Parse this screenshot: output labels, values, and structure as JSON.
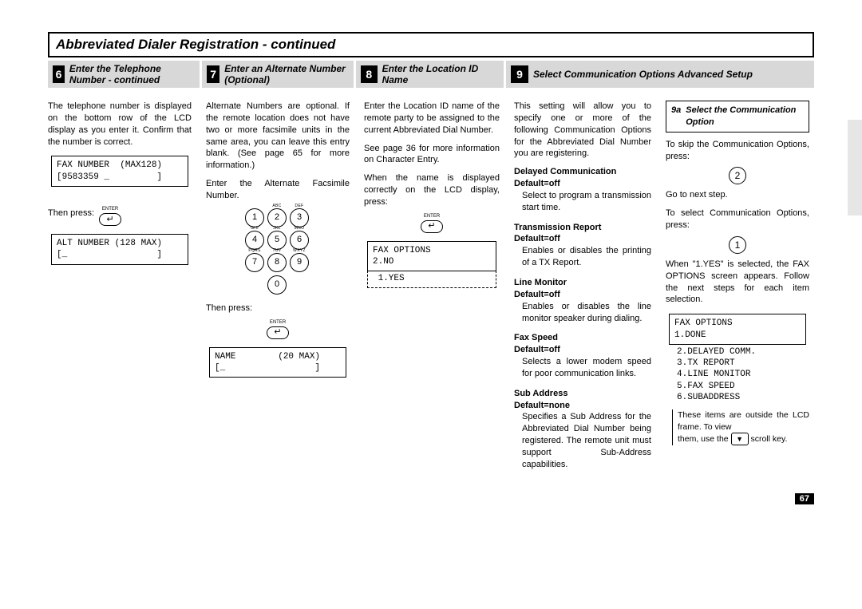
{
  "title": "Abbreviated Dialer Registration - continued",
  "page_number": "67",
  "steps": {
    "s6": {
      "num": "6",
      "label": "Enter the Telephone Number - continued"
    },
    "s7": {
      "num": "7",
      "label": "Enter an Alternate Number (Optional)"
    },
    "s8": {
      "num": "8",
      "label": "Enter the Location ID Name"
    },
    "s9": {
      "num": "9",
      "label": "Select Communication Options Advanced Setup"
    }
  },
  "col1": {
    "p1": "The telephone number is displayed on the bottom row of the LCD display as you enter it. Confirm that the number is correct.",
    "lcd1": "FAX NUMBER  (MAX128)\n[9583359 _         ]",
    "then_press": "Then press:",
    "enter": "ENTER",
    "enter_symbol": "↵",
    "lcd2": "ALT NUMBER (128 MAX)\n[_                 ]"
  },
  "col2": {
    "p1": "Alternate Numbers are optional. If the remote location does not have two or more facsimile units in the same area, you can leave this entry blank. (See page 65 for more information.)",
    "p2": "Enter the Alternate Facsimile Number.",
    "then_press": "Then press:",
    "enter": "ENTER",
    "enter_symbol": "↵",
    "lcd1": "NAME        (20 MAX)\n[_                 ]",
    "keypad": {
      "k1": {
        "d": "1",
        "t": ""
      },
      "k2": {
        "d": "2",
        "t": "ABC"
      },
      "k3": {
        "d": "3",
        "t": "DEF"
      },
      "k4": {
        "d": "4",
        "t": "GHI"
      },
      "k5": {
        "d": "5",
        "t": "JKL"
      },
      "k6": {
        "d": "6",
        "t": "MNO"
      },
      "k7": {
        "d": "7",
        "t": "PQRS"
      },
      "k8": {
        "d": "8",
        "t": "TUV"
      },
      "k9": {
        "d": "9",
        "t": "WXYZ"
      },
      "k0": {
        "d": "0",
        "t": ""
      }
    }
  },
  "col3": {
    "p1": "Enter the Location ID name of the remote party to be assigned to the current Abbreviated Dial Number.",
    "p2": "See page 36 for more information on  Character Entry.",
    "p3": "When the name is displayed correctly on the LCD display, press:",
    "enter": "ENTER",
    "enter_symbol": "↵",
    "lcd_top": "FAX OPTIONS\n2.NO",
    "lcd_dash": " 1.YES"
  },
  "col4": {
    "intro": "This setting will allow you to specify one or more of the following Communication Options for the Abbreviated Dial Number you are registering.",
    "opts": {
      "delayed": {
        "h": "Delayed Communication",
        "d": "Default=off",
        "b": "Select to program a transmission start time."
      },
      "tx": {
        "h": "Transmission Report",
        "d": "Default=off",
        "b": "Enables or disables the printing of a TX Report."
      },
      "line": {
        "h": "Line Monitor",
        "d": "Default=off",
        "b": "Enables or disables the line monitor speaker during dialing."
      },
      "speed": {
        "h": "Fax Speed",
        "d": "Default=off",
        "b": "Selects a lower modem speed for poor communication links."
      },
      "sub": {
        "h": "Sub Address",
        "d": "Default=none",
        "b": "Specifies a Sub Address for the Abbreviated Dial Number being registered. The remote unit must support Sub-Address capabilities."
      }
    }
  },
  "col5": {
    "sub9a_num": "9a",
    "sub9a_label": "Select the Communication Option",
    "p1": "To skip the Communication Options, press:",
    "btn2": "2",
    "p2": "Go to next step.",
    "p3": "To select Communication Options, press:",
    "btn1": "1",
    "p4": "When \"1.YES\" is selected, the FAX OPTIONS screen appears. Follow the next steps for each item selection.",
    "lcd_top": "FAX OPTIONS\n1.DONE",
    "lcd_extra": "2.DELAYED COMM.\n3.TX REPORT\n4.LINE MONITOR\n5.FAX SPEED\n6.SUBADDRESS",
    "note1": "These items are outside the LCD frame. To view",
    "note2_a": "them, use the ",
    "scroll": "▼",
    "note2_b": " scroll key."
  }
}
